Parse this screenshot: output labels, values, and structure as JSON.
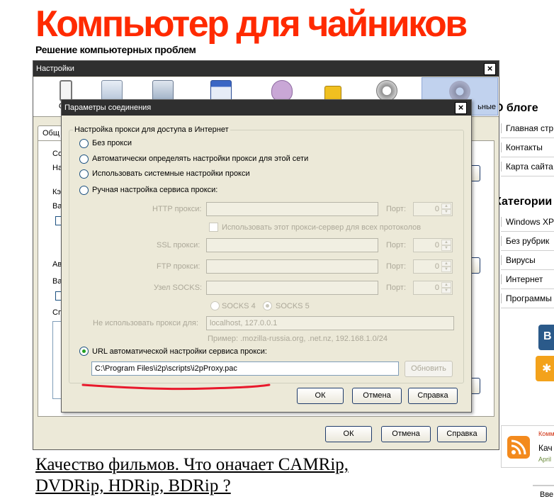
{
  "site": {
    "title": "Компьютер для чайников",
    "subtitle": "Решение компьютерных проблем",
    "article_title_line1": "Качество фильмов. Что оначает CAMRip,",
    "article_title_line2": "DVDRip, HDRip, BDRip ?",
    "sidebar": {
      "about_heading": "О блоге",
      "about_items": [
        "Главная стр",
        "Контакты",
        "Карта сайта"
      ],
      "categories_heading": "Категории",
      "categories_items": [
        "Windows XP",
        "Без рубрик",
        "Вирусы",
        "Интернет",
        "Программы"
      ],
      "comments_label": "Комм",
      "comments_subtitle": "Кач",
      "comments_date": "April",
      "bottom_label": "Вве"
    }
  },
  "settings_window": {
    "title": "Настройки",
    "close_label": "×",
    "toolbar": [
      {
        "label": "Осн",
        "icon": "general-icon"
      },
      {
        "label": "",
        "icon": "tabs-icon"
      },
      {
        "label": "",
        "icon": "content-icon"
      },
      {
        "label": "",
        "icon": "applications-icon"
      },
      {
        "label": "",
        "icon": "privacy-mask-icon"
      },
      {
        "label": "",
        "icon": "security-lock-icon"
      },
      {
        "label": "",
        "icon": "sync-icon"
      },
      {
        "label": "ьные",
        "icon": "advanced-gear-icon"
      }
    ],
    "tab_label": "Общ",
    "left_labels": [
      "Со",
      "На",
      "Кэ",
      "Ва",
      "Ав",
      "Ва",
      "Сп"
    ],
    "ok_label": "ОК",
    "cancel_label": "Отмена",
    "help_label": "Справка"
  },
  "connection_dialog": {
    "title": "Параметры соединения",
    "close_label": "×",
    "group_title": "Настройка прокси для доступа в Интернет",
    "options": {
      "no_proxy": "Без прокси",
      "auto_detect": "Автоматически определять настройки прокси для этой сети",
      "system": "Использовать системные настройки прокси",
      "manual": "Ручная настройка сервиса прокси:",
      "auto_url": "URL автоматической настройки сервиса прокси:"
    },
    "selected_option": "auto_url",
    "http_label": "HTTP прокси:",
    "ssl_label": "SSL прокси:",
    "ftp_label": "FTP прокси:",
    "socks_label": "Узел SOCKS:",
    "port_label": "Порт:",
    "port_value": "0",
    "use_for_all": "Использовать этот прокси-сервер для всех протоколов",
    "socks4": "SOCKS 4",
    "socks5": "SOCKS 5",
    "no_proxy_for_label": "Не использовать прокси для:",
    "no_proxy_for_value": "localhost, 127.0.0.1",
    "example_hint": "Пример: .mozilla-russia.org, .net.nz, 192.168.1.0/24",
    "pac_url": "C:\\Program Files\\i2p\\scripts\\i2pProxy.pac",
    "reload_label": "Обновить",
    "ok_label": "ОК",
    "cancel_label": "Отмена",
    "help_label": "Справка"
  },
  "colors": {
    "site_title": "#ff2a00",
    "titlebar": "#2f2f2f",
    "window_face": "#ece9d8",
    "annotation_underline": "#e8192c",
    "radio_checked": "#21a121"
  }
}
